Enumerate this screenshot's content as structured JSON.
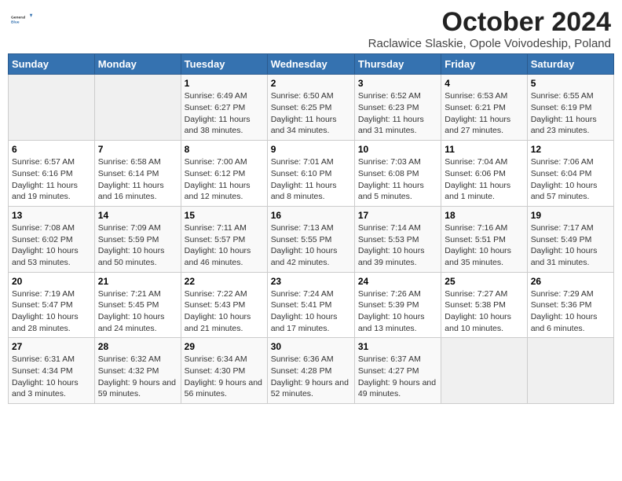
{
  "logo": {
    "text_general": "General",
    "text_blue": "Blue"
  },
  "header": {
    "month_title": "October 2024",
    "subtitle": "Raclawice Slaskie, Opole Voivodeship, Poland"
  },
  "weekdays": [
    "Sunday",
    "Monday",
    "Tuesday",
    "Wednesday",
    "Thursday",
    "Friday",
    "Saturday"
  ],
  "weeks": [
    [
      {
        "day": "",
        "info": ""
      },
      {
        "day": "",
        "info": ""
      },
      {
        "day": "1",
        "info": "Sunrise: 6:49 AM\nSunset: 6:27 PM\nDaylight: 11 hours and 38 minutes."
      },
      {
        "day": "2",
        "info": "Sunrise: 6:50 AM\nSunset: 6:25 PM\nDaylight: 11 hours and 34 minutes."
      },
      {
        "day": "3",
        "info": "Sunrise: 6:52 AM\nSunset: 6:23 PM\nDaylight: 11 hours and 31 minutes."
      },
      {
        "day": "4",
        "info": "Sunrise: 6:53 AM\nSunset: 6:21 PM\nDaylight: 11 hours and 27 minutes."
      },
      {
        "day": "5",
        "info": "Sunrise: 6:55 AM\nSunset: 6:19 PM\nDaylight: 11 hours and 23 minutes."
      }
    ],
    [
      {
        "day": "6",
        "info": "Sunrise: 6:57 AM\nSunset: 6:16 PM\nDaylight: 11 hours and 19 minutes."
      },
      {
        "day": "7",
        "info": "Sunrise: 6:58 AM\nSunset: 6:14 PM\nDaylight: 11 hours and 16 minutes."
      },
      {
        "day": "8",
        "info": "Sunrise: 7:00 AM\nSunset: 6:12 PM\nDaylight: 11 hours and 12 minutes."
      },
      {
        "day": "9",
        "info": "Sunrise: 7:01 AM\nSunset: 6:10 PM\nDaylight: 11 hours and 8 minutes."
      },
      {
        "day": "10",
        "info": "Sunrise: 7:03 AM\nSunset: 6:08 PM\nDaylight: 11 hours and 5 minutes."
      },
      {
        "day": "11",
        "info": "Sunrise: 7:04 AM\nSunset: 6:06 PM\nDaylight: 11 hours and 1 minute."
      },
      {
        "day": "12",
        "info": "Sunrise: 7:06 AM\nSunset: 6:04 PM\nDaylight: 10 hours and 57 minutes."
      }
    ],
    [
      {
        "day": "13",
        "info": "Sunrise: 7:08 AM\nSunset: 6:02 PM\nDaylight: 10 hours and 53 minutes."
      },
      {
        "day": "14",
        "info": "Sunrise: 7:09 AM\nSunset: 5:59 PM\nDaylight: 10 hours and 50 minutes."
      },
      {
        "day": "15",
        "info": "Sunrise: 7:11 AM\nSunset: 5:57 PM\nDaylight: 10 hours and 46 minutes."
      },
      {
        "day": "16",
        "info": "Sunrise: 7:13 AM\nSunset: 5:55 PM\nDaylight: 10 hours and 42 minutes."
      },
      {
        "day": "17",
        "info": "Sunrise: 7:14 AM\nSunset: 5:53 PM\nDaylight: 10 hours and 39 minutes."
      },
      {
        "day": "18",
        "info": "Sunrise: 7:16 AM\nSunset: 5:51 PM\nDaylight: 10 hours and 35 minutes."
      },
      {
        "day": "19",
        "info": "Sunrise: 7:17 AM\nSunset: 5:49 PM\nDaylight: 10 hours and 31 minutes."
      }
    ],
    [
      {
        "day": "20",
        "info": "Sunrise: 7:19 AM\nSunset: 5:47 PM\nDaylight: 10 hours and 28 minutes."
      },
      {
        "day": "21",
        "info": "Sunrise: 7:21 AM\nSunset: 5:45 PM\nDaylight: 10 hours and 24 minutes."
      },
      {
        "day": "22",
        "info": "Sunrise: 7:22 AM\nSunset: 5:43 PM\nDaylight: 10 hours and 21 minutes."
      },
      {
        "day": "23",
        "info": "Sunrise: 7:24 AM\nSunset: 5:41 PM\nDaylight: 10 hours and 17 minutes."
      },
      {
        "day": "24",
        "info": "Sunrise: 7:26 AM\nSunset: 5:39 PM\nDaylight: 10 hours and 13 minutes."
      },
      {
        "day": "25",
        "info": "Sunrise: 7:27 AM\nSunset: 5:38 PM\nDaylight: 10 hours and 10 minutes."
      },
      {
        "day": "26",
        "info": "Sunrise: 7:29 AM\nSunset: 5:36 PM\nDaylight: 10 hours and 6 minutes."
      }
    ],
    [
      {
        "day": "27",
        "info": "Sunrise: 6:31 AM\nSunset: 4:34 PM\nDaylight: 10 hours and 3 minutes."
      },
      {
        "day": "28",
        "info": "Sunrise: 6:32 AM\nSunset: 4:32 PM\nDaylight: 9 hours and 59 minutes."
      },
      {
        "day": "29",
        "info": "Sunrise: 6:34 AM\nSunset: 4:30 PM\nDaylight: 9 hours and 56 minutes."
      },
      {
        "day": "30",
        "info": "Sunrise: 6:36 AM\nSunset: 4:28 PM\nDaylight: 9 hours and 52 minutes."
      },
      {
        "day": "31",
        "info": "Sunrise: 6:37 AM\nSunset: 4:27 PM\nDaylight: 9 hours and 49 minutes."
      },
      {
        "day": "",
        "info": ""
      },
      {
        "day": "",
        "info": ""
      }
    ]
  ]
}
